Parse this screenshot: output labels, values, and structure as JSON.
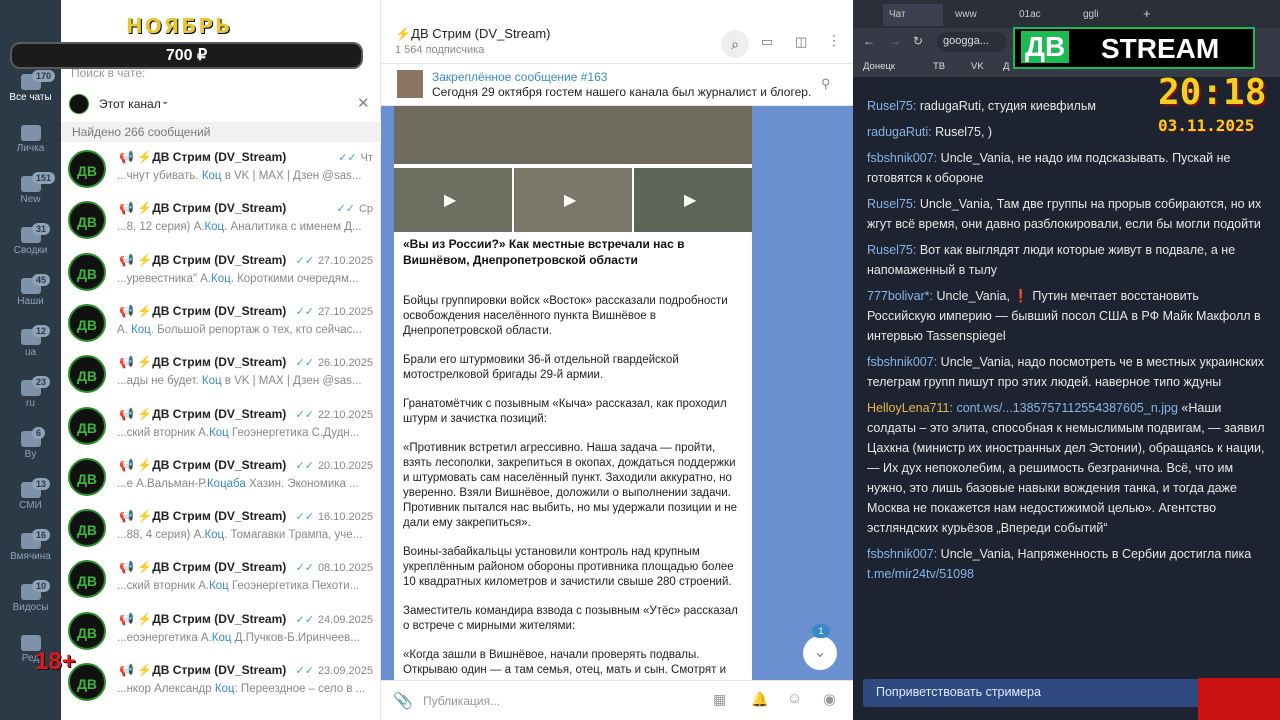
{
  "overlay": {
    "month": "НОЯБРЬ",
    "goal": "700 ₽",
    "logo_left": "ДВ",
    "logo_right": "STREAM",
    "time": "20:18",
    "date": "03.11.2025",
    "age": "18+"
  },
  "rail": [
    {
      "label": "Все чаты",
      "badge": "170"
    },
    {
      "label": "Личка",
      "badge": ""
    },
    {
      "label": "New",
      "badge": "151"
    },
    {
      "label": "Сводки",
      "badge": "31"
    },
    {
      "label": "Наши",
      "badge": "45"
    },
    {
      "label": "ua",
      "badge": "12"
    },
    {
      "label": "ru",
      "badge": "23"
    },
    {
      "label": "By",
      "badge": "6"
    },
    {
      "label": "СМИ",
      "badge": "13"
    },
    {
      "label": "Вмячина",
      "badge": "16"
    },
    {
      "label": "Видосы",
      "badge": "10"
    },
    {
      "label": "Ред",
      "badge": ""
    }
  ],
  "chatlist": {
    "search_placeholder": "Поиск в чате:",
    "filter": "Этот канал",
    "found": "Найдено 266 сообщений",
    "rows": [
      {
        "name": "📢 ⚡ДВ Стрим (DV_Stream)",
        "date": "Чт",
        "pre": "...чнут убивать. ",
        "hl": "Коц",
        "post": " в VK | MAX | Дзен @sas..."
      },
      {
        "name": "📢 ⚡ДВ Стрим (DV_Stream)",
        "date": "Ср",
        "pre": "...8, 12 серия) А.",
        "hl": "Коц",
        "post": ". Аналитика с именем Д..."
      },
      {
        "name": "📢 ⚡ДВ Стрим (DV_Stream)",
        "date": "27.10.2025",
        "pre": "...уревестника\" А.",
        "hl": "Коц",
        "post": ". Короткими очередям..."
      },
      {
        "name": "📢 ⚡ДВ Стрим (DV_Stream)",
        "date": "27.10.2025",
        "pre": "А. ",
        "hl": "Коц",
        "post": ". Большой репортаж о тех, кто сейчас..."
      },
      {
        "name": "📢 ⚡ДВ Стрим (DV_Stream)",
        "date": "26.10.2025",
        "pre": "...ады не будет. ",
        "hl": "Коц",
        "post": " в VK | MAX | Дзен @sas..."
      },
      {
        "name": "📢 ⚡ДВ Стрим (DV_Stream)",
        "date": "22.10.2025",
        "pre": "...ский вторник А.",
        "hl": "Коц",
        "post": " Геоэнергетика С.Дудн..."
      },
      {
        "name": "📢 ⚡ДВ Стрим (DV_Stream)",
        "date": "20.10.2025",
        "pre": "...е А.Вальман-Р.",
        "hl": "Коцаба",
        "post": " Хазин. Экономика ..."
      },
      {
        "name": "📢 ⚡ДВ Стрим (DV_Stream)",
        "date": "16.10.2025",
        "pre": "...88, 4 серия) А.",
        "hl": "Коц",
        "post": ". Томагавки Трампа, уче..."
      },
      {
        "name": "📢 ⚡ДВ Стрим (DV_Stream)",
        "date": "08.10.2025",
        "pre": "...ский вторник А.",
        "hl": "Коц",
        "post": " Геоэнергетика Пехоти..."
      },
      {
        "name": "📢 ⚡ДВ Стрим (DV_Stream)",
        "date": "24.09.2025",
        "pre": "...еоэнергетика А.",
        "hl": "Коц",
        "post": " Д.Пучков-Б.Иринчеев..."
      },
      {
        "name": "📢 ⚡ДВ Стрим (DV_Stream)",
        "date": "23.09.2025",
        "pre": "...нкор Александр ",
        "hl": "Коц",
        "post": ": Переездное – село в ..."
      }
    ]
  },
  "channel": {
    "title": "⚡ДВ Стрим (DV_Stream)",
    "subs": "1 564 подписчика",
    "pinned_title": "Закреплённое сообщение #163",
    "pinned_text": "Сегодня 29 октября гостем нашего канала был журналист и блогер...",
    "post_title": "«Вы из России?» Как местные встречали нас в Вишнёвом, Днепропетровской области",
    "paras": [
      "Бойцы группировки войск «Восток» рассказали подробности освобождения населённого пункта Вишнёвое в Днепропетровской области.",
      "Брали его штурмовики 36-й отдельной гвардейской мотострелковой бригады 29-й армии.",
      "Гранатомётчик с позывным «Кыча» рассказал, как проходил штурм и зачистка позиций:",
      "«Противник встретил агрессивно. Наша задача — пройти, взять лесополки, закрепиться в окопах, дождаться поддержки и штурмовать сам населённый пункт. Заходили аккуратно, но уверенно. Взяли Вишнёвое, доложили о выполнении задачи. Противник пытался нас выбить, но мы удержали позиции и не дали ему закрепиться».",
      "Воины-забайкальцы установили контроль над крупным укреплённым районом обороны противника площадью более 10 квадратных километров и зачистили свыше 280 строений.",
      "Заместитель командира взвода с позывным «Утёс» рассказал о встрече с мирными жителями:",
      "«Когда зашли в Вишнёвое, начали проверять подвалы. Открываю один — а там семья, отец, мать и сын. Смотрят и"
    ],
    "composer_placeholder": "Публикация...",
    "unread": "1"
  },
  "browser": {
    "tabs": [
      "Чат",
      "www",
      "01ac",
      "ggli"
    ],
    "url": "googga...",
    "bookmarks": [
      "Донецк",
      "ТВ",
      "VK",
      "Д"
    ],
    "messages": [
      {
        "user": "Rusel75:",
        "text": " radugaRuti, студия киевфильм"
      },
      {
        "user": "radugaRuti:",
        "text": " Rusel75, )"
      },
      {
        "user": "fsbshnik007:",
        "text": " Uncle_Vania, не надо им подсказывать. Пускай не готовятся к обороне"
      },
      {
        "user": "Rusel75:",
        "text": " Uncle_Vania, Там две группы на прорыв собираются, но их жгут всё время, они давно разблокировали, если бы могли подойти"
      },
      {
        "user": "Rusel75:",
        "text": " Вот как выглядят люди которые живут в подвале, а не напомаженный в тылу"
      },
      {
        "user": "777bolivar*:",
        "text": " Uncle_Vania, ❗ Путин мечтает восстановить Российскую империю — бывший посол США в РФ Майк Макфолл в интервью Tassenspiegel"
      },
      {
        "user": "fsbshnik007:",
        "text": " Uncle_Vania, надо посмотреть че в местных украинских телеграм групп пишут про этих людей. наверное типо ждуны"
      },
      {
        "user": "HelloyLena711:",
        "link": "cont.ws/...1385757112554387605_n.jpg",
        "text": " «Наши солдаты – это элита, способная к немыслимым подвигам, — заявил Цахкна (министр их иностранных дел Эстонии), обращаясь к нации, — Их дух непоколебим, а решимость безгранична. Всё, что им нужно, это лишь базовые навыки вождения танка, и тогда даже Москва не покажется нам недостижимой целью». Агентство эстляндских курьёзов „Впереди событий“"
      },
      {
        "user": "fsbshnik007:",
        "text": " Uncle_Vania, Напряженность в Сербии достигла пика ",
        "link2": "t.me/mir24tv/51098"
      }
    ],
    "greet": "Поприветствовать стримера"
  }
}
